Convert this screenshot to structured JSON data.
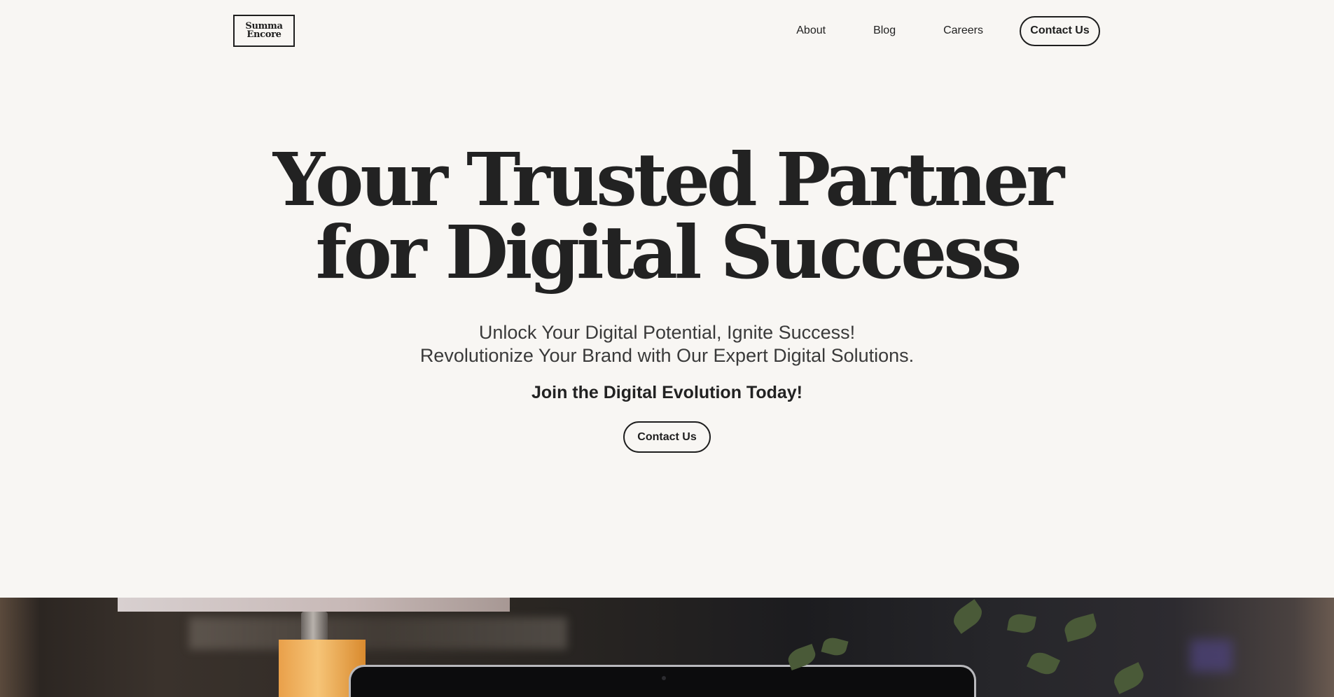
{
  "header": {
    "logo": {
      "line1": "Summa",
      "line2": "Encore"
    },
    "nav": [
      {
        "label": "About"
      },
      {
        "label": "Blog"
      },
      {
        "label": "Careers"
      }
    ],
    "contact_label": "Contact Us"
  },
  "hero": {
    "title_line1": "Your Trusted Partner",
    "title_line2": "for Digital Success",
    "subtitle_line1": "Unlock Your Digital Potential, Ignite Success!",
    "subtitle_line2": "Revolutionize Your Brand with Our Expert Digital Solutions.",
    "cta_text": "Join the Digital Evolution Today!",
    "button_label": "Contact Us"
  },
  "colors": {
    "background": "#f8f6f3",
    "text": "#222222",
    "border": "#1e1e1e"
  }
}
